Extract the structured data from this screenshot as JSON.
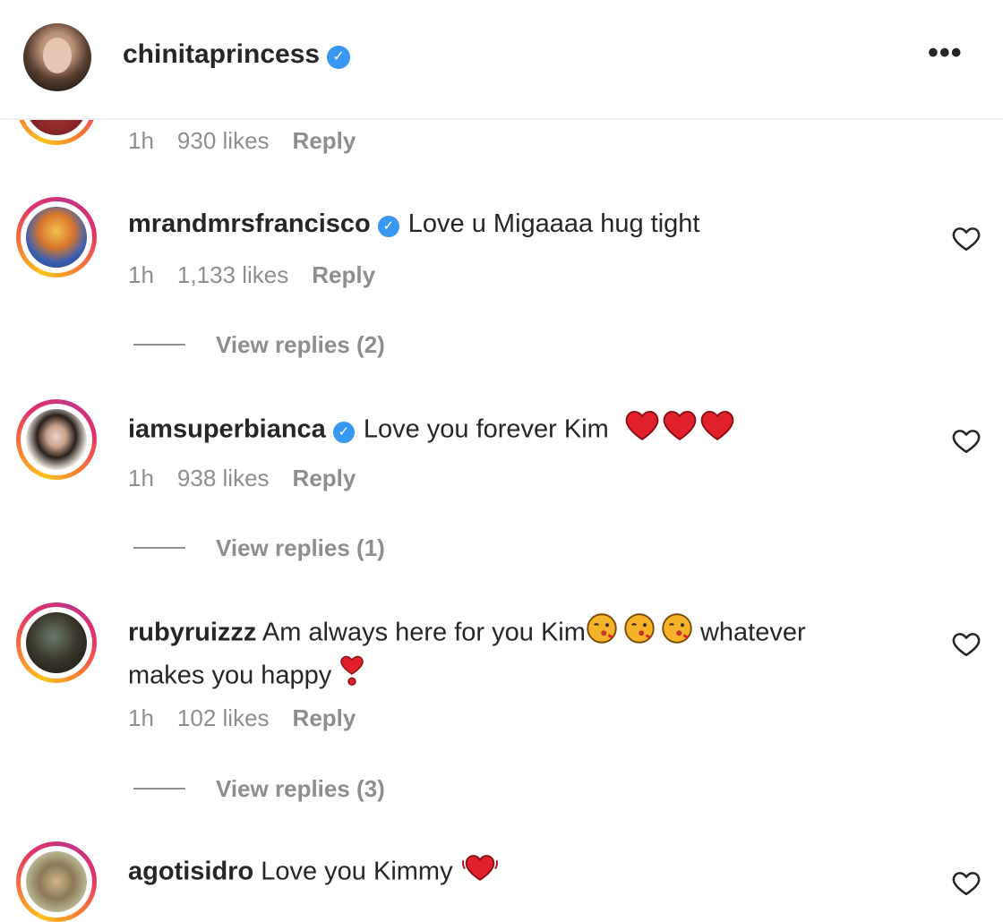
{
  "header": {
    "username": "chinitaprincess",
    "verified_glyph": "✓",
    "more_glyph": "•••"
  },
  "top_comment": {
    "time": "1h",
    "likes": "930 likes",
    "reply_label": "Reply"
  },
  "comments": [
    {
      "username": "mrandmrsfrancisco",
      "verified": true,
      "text": "Love u Migaaaa hug tight",
      "time": "1h",
      "likes": "1,133 likes",
      "reply_label": "Reply",
      "view_replies": "View replies (2)"
    },
    {
      "username": "iamsuperbianca",
      "verified": true,
      "text": "Love you forever Kim",
      "emoji": [
        "heart",
        "heart",
        "heart"
      ],
      "time": "1h",
      "likes": "938 likes",
      "reply_label": "Reply",
      "view_replies": "View replies (1)"
    },
    {
      "username": "rubyruizzz",
      "verified": false,
      "text_part1": "Am always here for you Kim",
      "emoji": [
        "kiss-face",
        "kiss-face",
        "kiss-face"
      ],
      "text_part2": "whatever",
      "text_line2": "makes you happy",
      "trailing_emoji": "heart-exclamation",
      "time": "1h",
      "likes": "102 likes",
      "reply_label": "Reply",
      "view_replies": "View replies (3)"
    },
    {
      "username": "agotisidro",
      "verified": false,
      "text": "Love you Kimmy",
      "emoji": [
        "beating-heart"
      ]
    }
  ],
  "colors": {
    "text": "#262626",
    "muted": "#8e8e8e",
    "verified": "#3897f0",
    "heart_emoji": "#e0202b"
  }
}
